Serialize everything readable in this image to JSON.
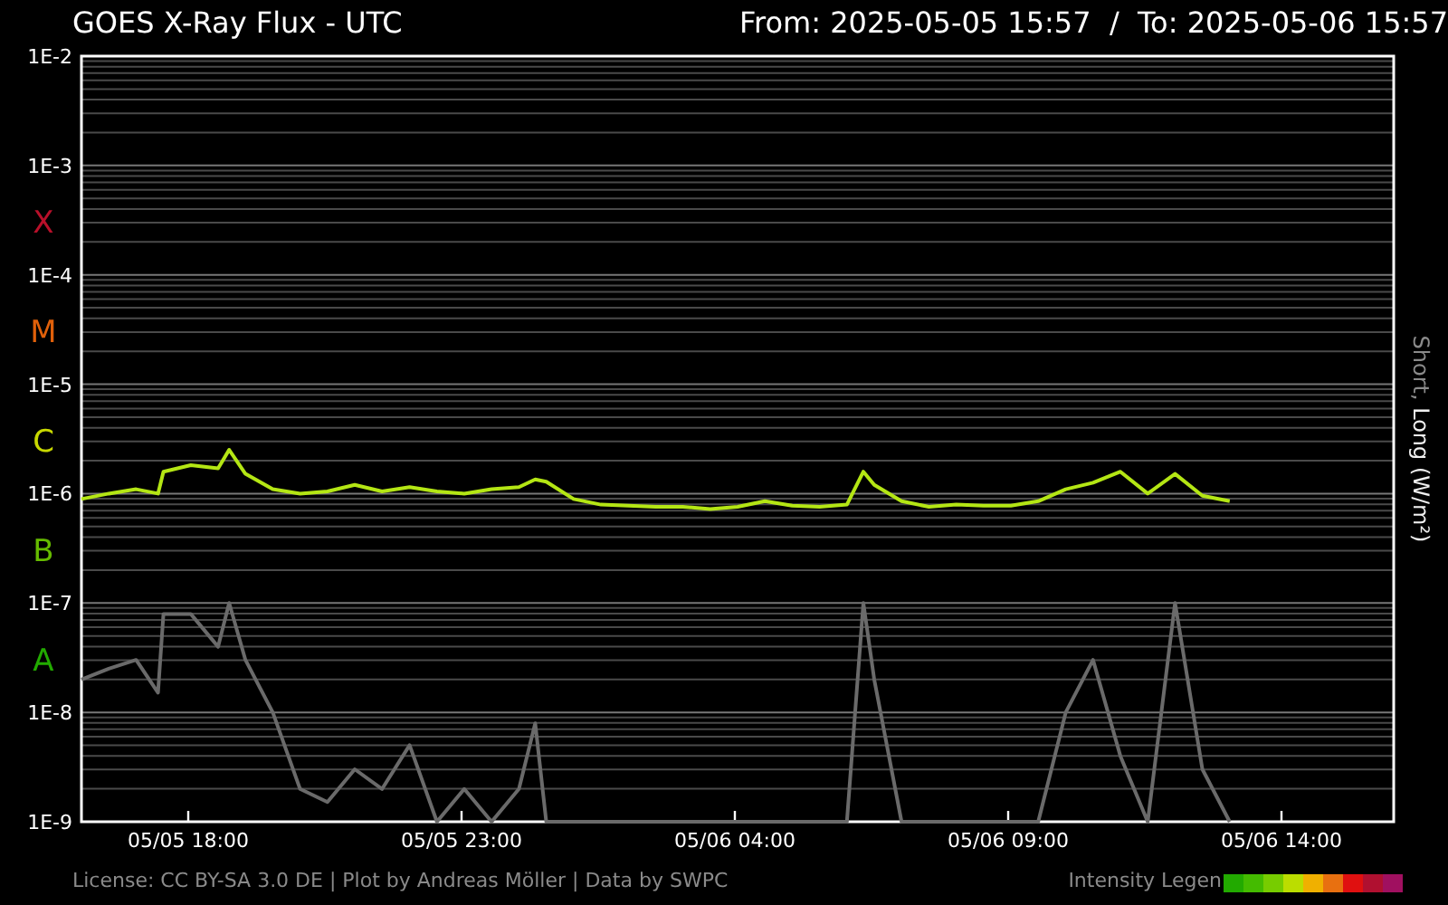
{
  "header": {
    "title": "GOES X-Ray Flux - UTC",
    "range": "From: 2025-05-05 15:57  /  To: 2025-05-06 15:57"
  },
  "plot": {
    "y_labels": [
      "1E-2",
      "1E-3",
      "1E-4",
      "1E-5",
      "1E-6",
      "1E-7",
      "1E-8",
      "1E-9"
    ],
    "x_labels": [
      "05/05 18:00",
      "05/05 23:00",
      "05/06 04:00",
      "05/06 09:00",
      "05/06 14:00"
    ],
    "axis_title": [
      "Short,",
      "Long (W/m²)"
    ]
  },
  "flare_classes": [
    {
      "label": "X",
      "color": "#b8102a"
    },
    {
      "label": "M",
      "color": "#e0600a"
    },
    {
      "label": "C",
      "color": "#c8d800"
    },
    {
      "label": "B",
      "color": "#66bb00"
    },
    {
      "label": "A",
      "color": "#22aa00"
    }
  ],
  "footer": {
    "credits": "License: CC BY-SA 3.0 DE | Plot by Andreas Möller | Data by SWPC",
    "legend_label": "Intensity Legen",
    "legend_swatches": [
      {
        "color": "#22aa00"
      },
      {
        "color": "#44bb00"
      },
      {
        "color": "#77cc00"
      },
      {
        "color": "#bbdd00"
      },
      {
        "color": "#f0b000"
      },
      {
        "color": "#e87010"
      },
      {
        "color": "#e01010"
      },
      {
        "color": "#b01030"
      },
      {
        "color": "#a01060"
      }
    ]
  }
}
